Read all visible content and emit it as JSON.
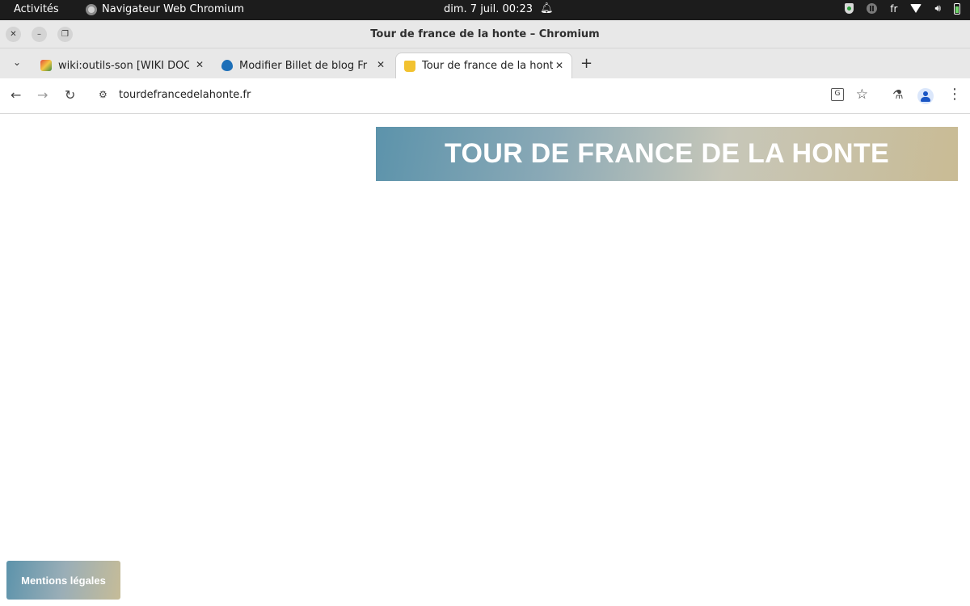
{
  "system_bar": {
    "activities": "Activités",
    "app_name": "Navigateur Web Chromium",
    "datetime": "dim. 7 juil.  00:23",
    "language": "fr"
  },
  "window": {
    "title": "Tour de france de la honte – Chromium"
  },
  "tabs": [
    {
      "title": "wiki:outils-son [WIKI DOC",
      "favicon": "wiki-pencil-icon",
      "active": false
    },
    {
      "title": "Modifier Billet de blog Fr",
      "favicon": "drupal-drop-icon",
      "active": false
    },
    {
      "title": "Tour de france de la honte",
      "favicon": "site-crown-icon",
      "active": true
    }
  ],
  "omnibox": {
    "url": "tourdefrancedelahonte.fr"
  },
  "page": {
    "banner_title": "TOUR DE FRANCE DE LA HONTE",
    "legal_button": "Mentions légales"
  },
  "colors": {
    "topbar_bg": "#1c1c1c",
    "banner_gradient_start": "#5c93ab",
    "banner_gradient_end": "#c9bb94"
  }
}
